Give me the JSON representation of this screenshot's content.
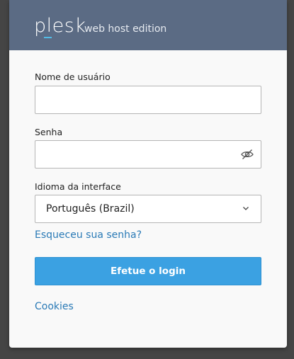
{
  "header": {
    "logo": "plesk",
    "edition": "web host edition"
  },
  "form": {
    "username": {
      "label": "Nome de usuário",
      "value": "",
      "placeholder": ""
    },
    "password": {
      "label": "Senha",
      "value": "",
      "placeholder": "",
      "toggle_icon": "eye-slash-icon"
    },
    "language": {
      "label": "Idioma da interface",
      "selected": "Português (Brazil)",
      "icon": "chevron-down-icon"
    },
    "forgot_link": "Esqueceu sua senha?",
    "login_button": "Efetue o login",
    "cookies_link": "Cookies"
  },
  "colors": {
    "header_bg": "#5b6b84",
    "accent": "#3ba1e2",
    "link": "#2a7ab6",
    "background": "#454545"
  }
}
